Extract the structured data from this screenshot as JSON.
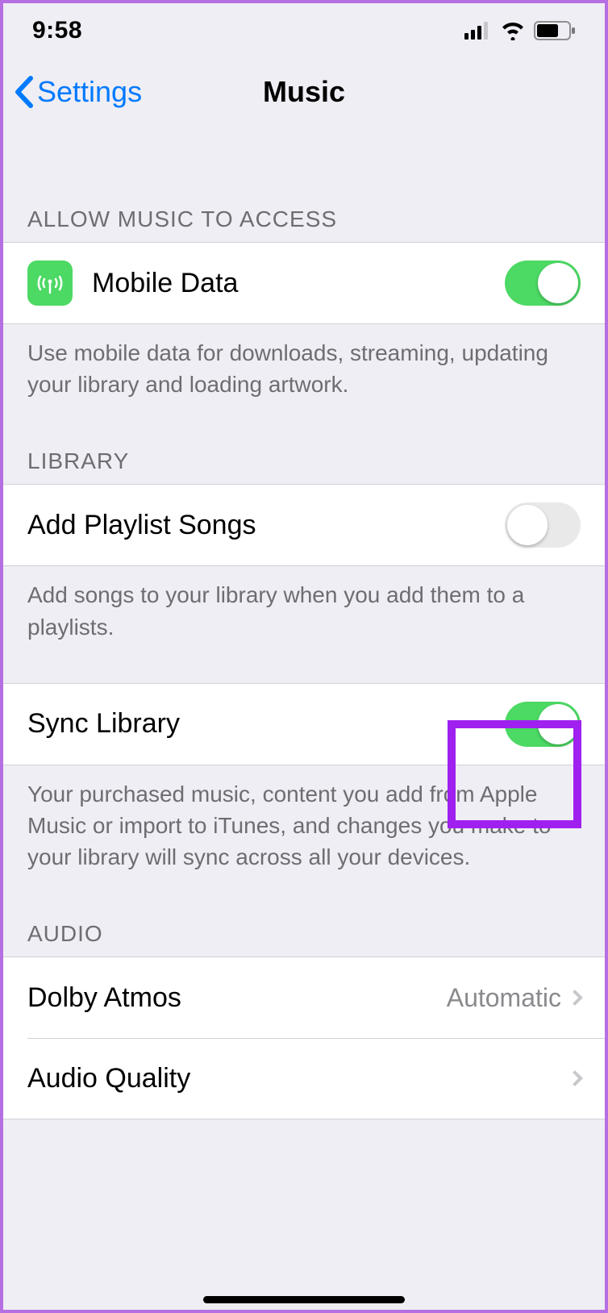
{
  "status": {
    "time": "9:58"
  },
  "nav": {
    "back_label": "Settings",
    "title": "Music"
  },
  "sections": {
    "access": {
      "header": "Allow Music to Access",
      "mobile_data": {
        "label": "Mobile Data",
        "on": true
      },
      "footer": "Use mobile data for downloads, streaming, updating your library and loading artwork."
    },
    "library": {
      "header": "Library",
      "add_playlist": {
        "label": "Add Playlist Songs",
        "on": false
      },
      "add_playlist_footer": "Add songs to your library when you add them to a playlists.",
      "sync": {
        "label": "Sync Library",
        "on": true
      },
      "sync_footer": "Your purchased music, content you add from Apple Music or import to iTunes, and changes you make to your library will sync across all your devices."
    },
    "audio": {
      "header": "Audio",
      "dolby": {
        "label": "Dolby Atmos",
        "value": "Automatic"
      },
      "quality": {
        "label": "Audio Quality"
      }
    }
  },
  "highlight": {
    "target": "sync-library-toggle"
  }
}
